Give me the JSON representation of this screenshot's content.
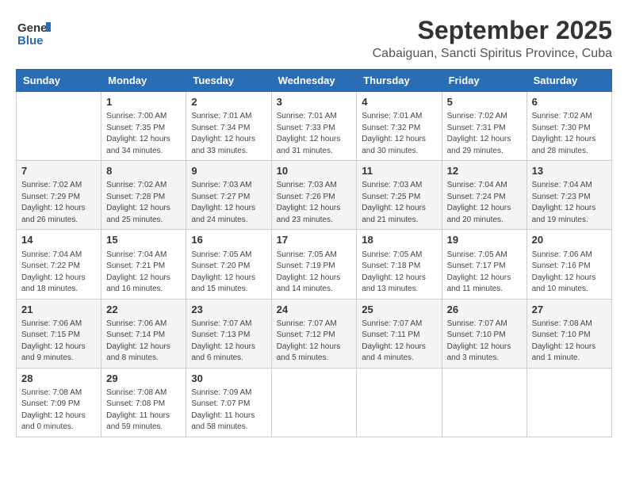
{
  "logo": {
    "general": "General",
    "blue": "Blue"
  },
  "title": "September 2025",
  "subtitle": "Cabaiguan, Sancti Spiritus Province, Cuba",
  "days": [
    "Sunday",
    "Monday",
    "Tuesday",
    "Wednesday",
    "Thursday",
    "Friday",
    "Saturday"
  ],
  "weeks": [
    [
      {
        "num": "",
        "text": ""
      },
      {
        "num": "1",
        "text": "Sunrise: 7:00 AM\nSunset: 7:35 PM\nDaylight: 12 hours\nand 34 minutes."
      },
      {
        "num": "2",
        "text": "Sunrise: 7:01 AM\nSunset: 7:34 PM\nDaylight: 12 hours\nand 33 minutes."
      },
      {
        "num": "3",
        "text": "Sunrise: 7:01 AM\nSunset: 7:33 PM\nDaylight: 12 hours\nand 31 minutes."
      },
      {
        "num": "4",
        "text": "Sunrise: 7:01 AM\nSunset: 7:32 PM\nDaylight: 12 hours\nand 30 minutes."
      },
      {
        "num": "5",
        "text": "Sunrise: 7:02 AM\nSunset: 7:31 PM\nDaylight: 12 hours\nand 29 minutes."
      },
      {
        "num": "6",
        "text": "Sunrise: 7:02 AM\nSunset: 7:30 PM\nDaylight: 12 hours\nand 28 minutes."
      }
    ],
    [
      {
        "num": "7",
        "text": "Sunrise: 7:02 AM\nSunset: 7:29 PM\nDaylight: 12 hours\nand 26 minutes."
      },
      {
        "num": "8",
        "text": "Sunrise: 7:02 AM\nSunset: 7:28 PM\nDaylight: 12 hours\nand 25 minutes."
      },
      {
        "num": "9",
        "text": "Sunrise: 7:03 AM\nSunset: 7:27 PM\nDaylight: 12 hours\nand 24 minutes."
      },
      {
        "num": "10",
        "text": "Sunrise: 7:03 AM\nSunset: 7:26 PM\nDaylight: 12 hours\nand 23 minutes."
      },
      {
        "num": "11",
        "text": "Sunrise: 7:03 AM\nSunset: 7:25 PM\nDaylight: 12 hours\nand 21 minutes."
      },
      {
        "num": "12",
        "text": "Sunrise: 7:04 AM\nSunset: 7:24 PM\nDaylight: 12 hours\nand 20 minutes."
      },
      {
        "num": "13",
        "text": "Sunrise: 7:04 AM\nSunset: 7:23 PM\nDaylight: 12 hours\nand 19 minutes."
      }
    ],
    [
      {
        "num": "14",
        "text": "Sunrise: 7:04 AM\nSunset: 7:22 PM\nDaylight: 12 hours\nand 18 minutes."
      },
      {
        "num": "15",
        "text": "Sunrise: 7:04 AM\nSunset: 7:21 PM\nDaylight: 12 hours\nand 16 minutes."
      },
      {
        "num": "16",
        "text": "Sunrise: 7:05 AM\nSunset: 7:20 PM\nDaylight: 12 hours\nand 15 minutes."
      },
      {
        "num": "17",
        "text": "Sunrise: 7:05 AM\nSunset: 7:19 PM\nDaylight: 12 hours\nand 14 minutes."
      },
      {
        "num": "18",
        "text": "Sunrise: 7:05 AM\nSunset: 7:18 PM\nDaylight: 12 hours\nand 13 minutes."
      },
      {
        "num": "19",
        "text": "Sunrise: 7:05 AM\nSunset: 7:17 PM\nDaylight: 12 hours\nand 11 minutes."
      },
      {
        "num": "20",
        "text": "Sunrise: 7:06 AM\nSunset: 7:16 PM\nDaylight: 12 hours\nand 10 minutes."
      }
    ],
    [
      {
        "num": "21",
        "text": "Sunrise: 7:06 AM\nSunset: 7:15 PM\nDaylight: 12 hours\nand 9 minutes."
      },
      {
        "num": "22",
        "text": "Sunrise: 7:06 AM\nSunset: 7:14 PM\nDaylight: 12 hours\nand 8 minutes."
      },
      {
        "num": "23",
        "text": "Sunrise: 7:07 AM\nSunset: 7:13 PM\nDaylight: 12 hours\nand 6 minutes."
      },
      {
        "num": "24",
        "text": "Sunrise: 7:07 AM\nSunset: 7:12 PM\nDaylight: 12 hours\nand 5 minutes."
      },
      {
        "num": "25",
        "text": "Sunrise: 7:07 AM\nSunset: 7:11 PM\nDaylight: 12 hours\nand 4 minutes."
      },
      {
        "num": "26",
        "text": "Sunrise: 7:07 AM\nSunset: 7:10 PM\nDaylight: 12 hours\nand 3 minutes."
      },
      {
        "num": "27",
        "text": "Sunrise: 7:08 AM\nSunset: 7:10 PM\nDaylight: 12 hours\nand 1 minute."
      }
    ],
    [
      {
        "num": "28",
        "text": "Sunrise: 7:08 AM\nSunset: 7:09 PM\nDaylight: 12 hours\nand 0 minutes."
      },
      {
        "num": "29",
        "text": "Sunrise: 7:08 AM\nSunset: 7:08 PM\nDaylight: 11 hours\nand 59 minutes."
      },
      {
        "num": "30",
        "text": "Sunrise: 7:09 AM\nSunset: 7:07 PM\nDaylight: 11 hours\nand 58 minutes."
      },
      {
        "num": "",
        "text": ""
      },
      {
        "num": "",
        "text": ""
      },
      {
        "num": "",
        "text": ""
      },
      {
        "num": "",
        "text": ""
      }
    ]
  ]
}
